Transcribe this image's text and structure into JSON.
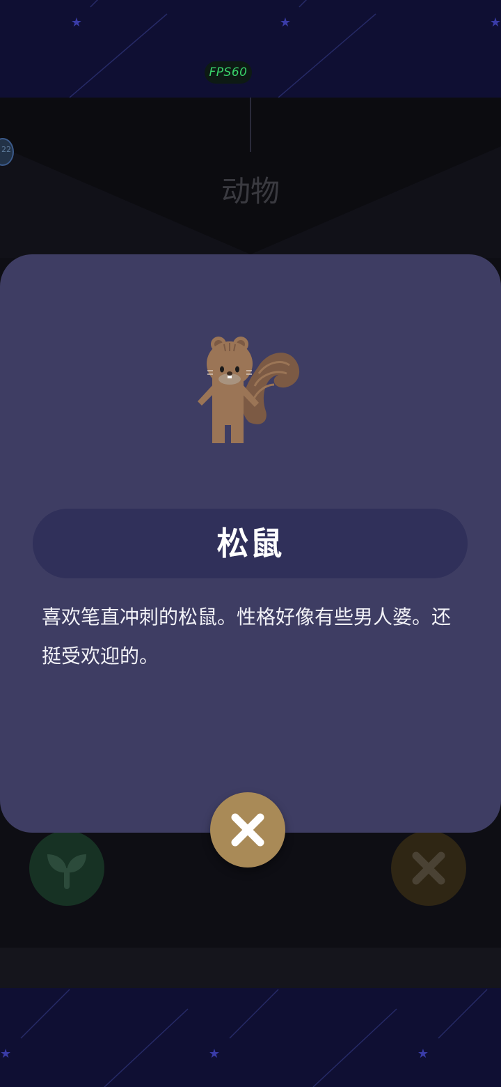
{
  "hud": {
    "fps": "FPS60",
    "level_badge": "22"
  },
  "header": {
    "category": "动物"
  },
  "modal": {
    "animal_name": "松鼠",
    "description": "喜欢笔直冲刺的松鼠。性格好像有些男人婆。还挺受欢迎的。",
    "illustration": "squirrel"
  },
  "buttons": {
    "close_icon": "close-icon",
    "sprout_icon": "sprout-icon"
  },
  "colors": {
    "modal_bg": "#3e3d63",
    "name_pill_bg": "#30305a",
    "close_button": "#a98a57",
    "fps_text": "#39d26a",
    "squirrel_fur": "#9b7556"
  }
}
